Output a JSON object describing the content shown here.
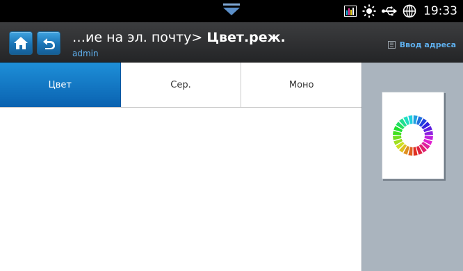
{
  "status_bar": {
    "time": "19:33",
    "icons": [
      "pull-down-handle-icon",
      "toner-level-icon",
      "brightness-icon",
      "usb-icon",
      "network-globe-icon"
    ]
  },
  "header": {
    "title_path": "…ие на эл. почту> ",
    "title_current": "Цвет.реж.",
    "user": "admin",
    "address_button_label": "Ввод адреса",
    "icons": [
      "home-icon",
      "back-icon",
      "address-book-icon"
    ]
  },
  "tabs": [
    {
      "label": "Цвет",
      "selected": true
    },
    {
      "label": "Сер.",
      "selected": false
    },
    {
      "label": "Моно",
      "selected": false
    }
  ],
  "preview": {
    "icon": "color-wheel-icon"
  },
  "colors": {
    "accent": "#1478c4",
    "header_bg": "#2e2f31",
    "side_panel": "#aab4be",
    "link": "#5fb0ee"
  }
}
